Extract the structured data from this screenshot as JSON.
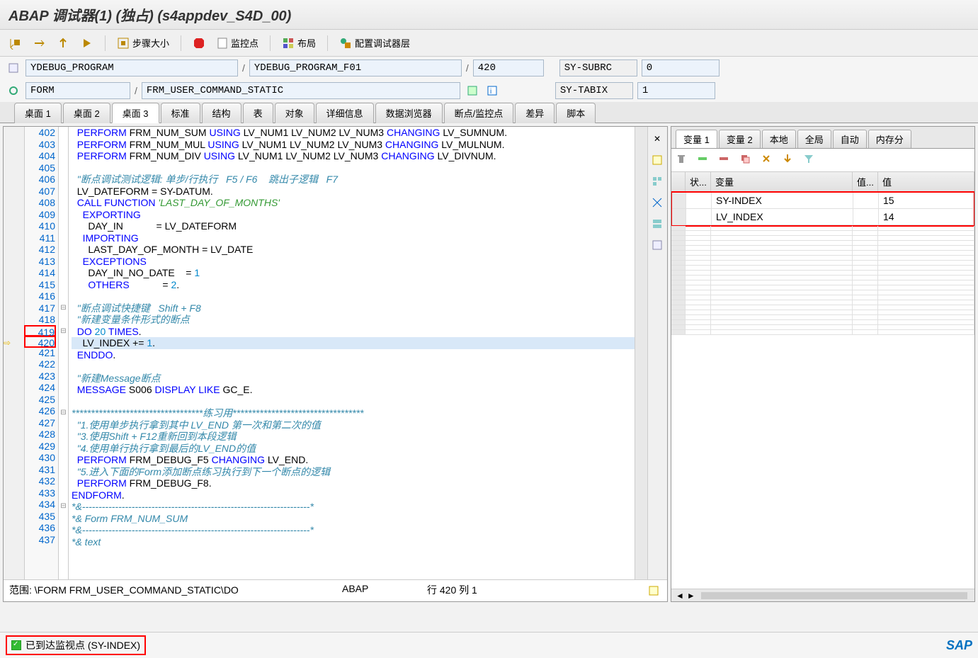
{
  "title": "ABAP 调试器(1)  (独占) (s4appdev_S4D_00)",
  "toolbar": {
    "step_size": "步骤大小",
    "watchpoint": "监控点",
    "layout": "布局",
    "config_layer": "配置调试器层"
  },
  "info": {
    "program": "YDEBUG_PROGRAM",
    "include": "YDEBUG_PROGRAM_F01",
    "line": "420",
    "sy_subrc_label": "SY-SUBRC",
    "sy_subrc_val": "0",
    "form_label": "FORM",
    "form_name": "FRM_USER_COMMAND_STATIC",
    "sy_tabix_label": "SY-TABIX",
    "sy_tabix_val": "1"
  },
  "tabs": [
    "桌面 1",
    "桌面 2",
    "桌面 3",
    "标准",
    "结构",
    "表",
    "对象",
    "详细信息",
    "数据浏览器",
    "断点/监控点",
    "差异",
    "脚本"
  ],
  "active_tab": 2,
  "code_status": {
    "scope": "范围:  \\FORM FRM_USER_COMMAND_STATIC\\DO",
    "lang": "ABAP",
    "pos": "行 420 列   1"
  },
  "var_tabs": [
    "变量 1",
    "变量 2",
    "本地",
    "全局",
    "自动",
    "内存分"
  ],
  "var_active": 0,
  "var_cols": {
    "status": "状...",
    "name": "变量",
    "valshort": "值...",
    "value": "值"
  },
  "vars": [
    {
      "name": "SY-INDEX",
      "value": "15"
    },
    {
      "name": "LV_INDEX",
      "value": "14"
    }
  ],
  "status_msg": "已到达监视点 (SY-INDEX)",
  "sap": "SAP",
  "lines": [
    {
      "n": 402,
      "html": "  <span class='kw'>PERFORM</span> FRM_NUM_SUM <span class='kw'>USING</span> LV_NUM1 LV_NUM2 LV_NUM3 <span class='kw'>CHANGING</span> LV_SUMNUM."
    },
    {
      "n": 403,
      "html": "  <span class='kw'>PERFORM</span> FRM_NUM_MUL <span class='kw'>USING</span> LV_NUM1 LV_NUM2 LV_NUM3 <span class='kw'>CHANGING</span> LV_MULNUM."
    },
    {
      "n": 404,
      "html": "  <span class='kw'>PERFORM</span> FRM_NUM_DIV <span class='kw'>USING</span> LV_NUM1 LV_NUM2 LV_NUM3 <span class='kw'>CHANGING</span> LV_DIVNUM."
    },
    {
      "n": 405,
      "html": ""
    },
    {
      "n": 406,
      "html": "  <span class='cmt'>\"断点调试测试逻辑: 单步/行执行   F5 / F6    跳出子逻辑   F7</span>"
    },
    {
      "n": 407,
      "html": "  LV_DATEFORM = SY-DATUM."
    },
    {
      "n": 408,
      "html": "  <span class='kw'>CALL FUNCTION</span> <span class='str'>'LAST_DAY_OF_MONTHS'</span>"
    },
    {
      "n": 409,
      "html": "    <span class='kw'>EXPORTING</span>"
    },
    {
      "n": 410,
      "html": "      DAY_IN            = LV_DATEFORM"
    },
    {
      "n": 411,
      "html": "    <span class='kw'>IMPORTING</span>"
    },
    {
      "n": 412,
      "html": "      LAST_DAY_OF_MONTH = LV_DATE"
    },
    {
      "n": 413,
      "html": "    <span class='kw'>EXCEPTIONS</span>"
    },
    {
      "n": 414,
      "html": "      DAY_IN_NO_DATE    = <span class='num'>1</span>"
    },
    {
      "n": 415,
      "html": "      <span class='kw'>OTHERS</span>            = <span class='num'>2</span>."
    },
    {
      "n": 416,
      "html": ""
    },
    {
      "n": 417,
      "html": "  <span class='cmt'>\"断点调试快捷键   Shift + F8</span>",
      "fold": "⊟"
    },
    {
      "n": 418,
      "html": "  <span class='cmt'>\"新建变量条件形式的断点</span>"
    },
    {
      "n": 419,
      "html": "  <span class='kw'>DO</span> <span class='num'>20</span> <span class='kw'>TIMES</span>.",
      "fold": "⊟",
      "redline": true
    },
    {
      "n": 420,
      "html": "    LV_INDEX += <span class='num'>1</span>.",
      "current": true,
      "arrow": true,
      "redline": true
    },
    {
      "n": 421,
      "html": "  <span class='kw'>ENDDO</span>."
    },
    {
      "n": 422,
      "html": ""
    },
    {
      "n": 423,
      "html": "  <span class='cmt'>\"新建Message断点</span>"
    },
    {
      "n": 424,
      "html": "  <span class='kw'>MESSAGE</span> S006 <span class='kw'>DISPLAY LIKE</span> GC_E."
    },
    {
      "n": 425,
      "html": ""
    },
    {
      "n": 426,
      "html": "<span class='cmt'>**********************************练习用**********************************</span>",
      "fold": "⊟"
    },
    {
      "n": 427,
      "html": "  <span class='cmt'>\"1.使用单步执行拿到其中 LV_END 第一次和第二次的值</span>"
    },
    {
      "n": 428,
      "html": "  <span class='cmt'>\"3.使用Shift + F12重新回到本段逻辑</span>"
    },
    {
      "n": 429,
      "html": "  <span class='cmt'>\"4.使用单行执行拿到最后的LV_END的值</span>"
    },
    {
      "n": 430,
      "html": "  <span class='kw'>PERFORM</span> FRM_DEBUG_F5 <span class='kw'>CHANGING</span> LV_END."
    },
    {
      "n": 431,
      "html": "  <span class='cmt'>\"5.进入下面的Form添加断点练习执行到下一个断点的逻辑</span>"
    },
    {
      "n": 432,
      "html": "  <span class='kw'>PERFORM</span> FRM_DEBUG_F8."
    },
    {
      "n": 433,
      "html": "<span class='kw'>ENDFORM</span>."
    },
    {
      "n": 434,
      "html": "<span class='cmt'>*&---------------------------------------------------------------------*</span>",
      "fold": "⊟"
    },
    {
      "n": 435,
      "html": "<span class='cmt'>*& Form FRM_NUM_SUM</span>"
    },
    {
      "n": 436,
      "html": "<span class='cmt'>*&---------------------------------------------------------------------*</span>"
    },
    {
      "n": 437,
      "html": "<span class='cmt'>*& text</span>"
    }
  ]
}
